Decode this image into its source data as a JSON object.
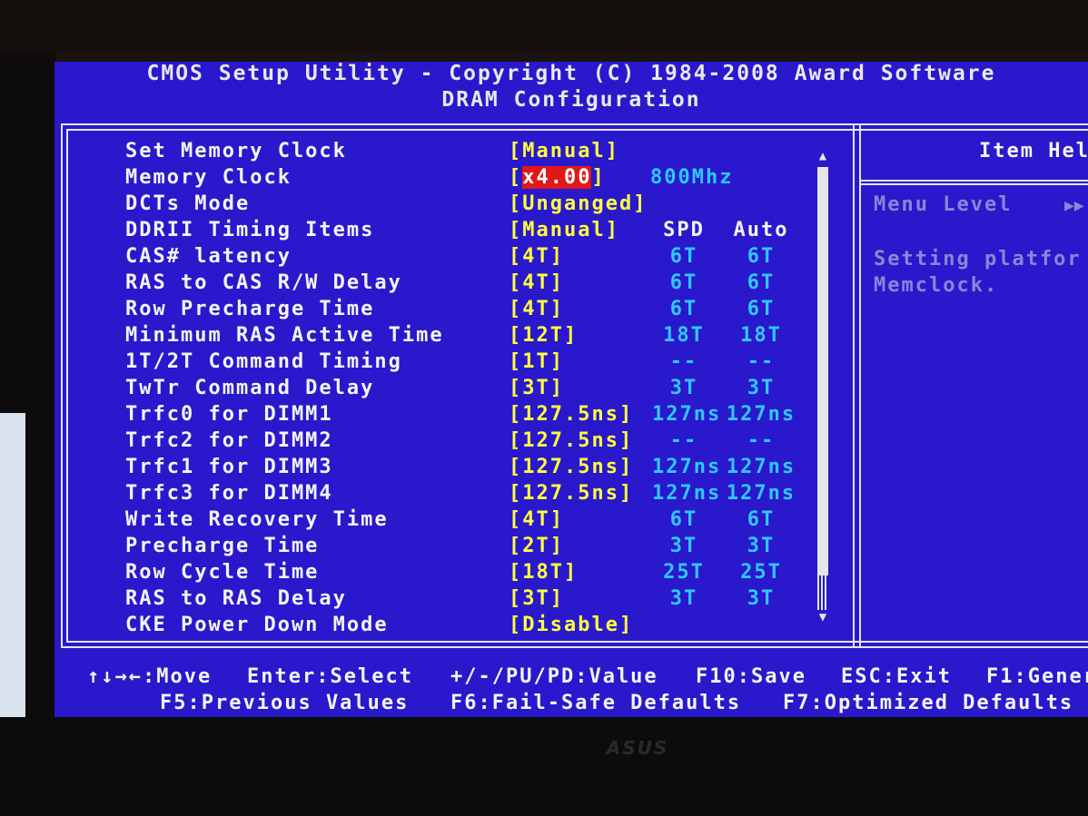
{
  "header": {
    "title_line1": "CMOS Setup Utility - Copyright (C) 1984-2008 Award Software",
    "title_line2": "DRAM Configuration"
  },
  "columns": {
    "spd": "SPD",
    "auto": "Auto"
  },
  "settings": [
    {
      "label": "Set Memory Clock",
      "value": "[Manual]"
    },
    {
      "label": "Memory Clock",
      "value_prefix": "[",
      "value_selected": "x4.00",
      "value_suffix": "]",
      "extra": "800Mhz"
    },
    {
      "label": "DCTs Mode",
      "value": "[Unganged]"
    },
    {
      "label": "DDRII Timing Items",
      "value": "[Manual]"
    },
    {
      "label": "CAS# latency",
      "value": "[4T]",
      "spd": "6T",
      "auto": "6T"
    },
    {
      "label": "RAS to CAS R/W Delay",
      "value": "[4T]",
      "spd": "6T",
      "auto": "6T"
    },
    {
      "label": "Row Precharge Time",
      "value": "[4T]",
      "spd": "6T",
      "auto": "6T"
    },
    {
      "label": "Minimum RAS Active Time",
      "value": "[12T]",
      "spd": "18T",
      "auto": "18T"
    },
    {
      "label": "1T/2T Command Timing",
      "value": "[1T]",
      "spd": "--",
      "auto": "--"
    },
    {
      "label": "TwTr Command Delay",
      "value": "[3T]",
      "spd": "3T",
      "auto": "3T"
    },
    {
      "label": "Trfc0 for DIMM1",
      "value": "[127.5ns]",
      "spd": "127ns",
      "auto": "127ns"
    },
    {
      "label": "Trfc2 for DIMM2",
      "value": "[127.5ns]",
      "spd": "--",
      "auto": "--"
    },
    {
      "label": "Trfc1 for DIMM3",
      "value": "[127.5ns]",
      "spd": "127ns",
      "auto": "127ns"
    },
    {
      "label": "Trfc3 for DIMM4",
      "value": "[127.5ns]",
      "spd": "127ns",
      "auto": "127ns"
    },
    {
      "label": "Write Recovery Time",
      "value": "[4T]",
      "spd": "6T",
      "auto": "6T"
    },
    {
      "label": "Precharge Time",
      "value": "[2T]",
      "spd": "3T",
      "auto": "3T"
    },
    {
      "label": "Row Cycle Time",
      "value": "[18T]",
      "spd": "25T",
      "auto": "25T"
    },
    {
      "label": "RAS to RAS Delay",
      "value": "[3T]",
      "spd": "3T",
      "auto": "3T"
    },
    {
      "label": "CKE Power Down Mode",
      "value": "[Disable]"
    }
  ],
  "help": {
    "title": "Item Hel",
    "menu_level": "Menu Level",
    "menu_arrow": "▶▶",
    "text_line1": "Setting platfor",
    "text_line2": "Memclock."
  },
  "footer": {
    "move": "↑↓→←:Move",
    "select": "Enter:Select",
    "value": "+/-/PU/PD:Value",
    "save": "F10:Save",
    "exit": "ESC:Exit",
    "general": "F1:Gener",
    "previous": "F5:Previous Values",
    "failsafe": "F6:Fail-Safe Defaults",
    "optimized": "F7:Optimized Defaults"
  },
  "scrollbar": {
    "up": "▲",
    "down": "▼",
    "position_fraction": 0.92
  },
  "brand": {
    "logo": "ASUS"
  },
  "colors": {
    "screen_bg": "#2a18cc",
    "value_yellow": "#ffff40",
    "info_cyan": "#2ec8ff",
    "selection_red": "#e01818",
    "help_text": "#8a86d8"
  }
}
